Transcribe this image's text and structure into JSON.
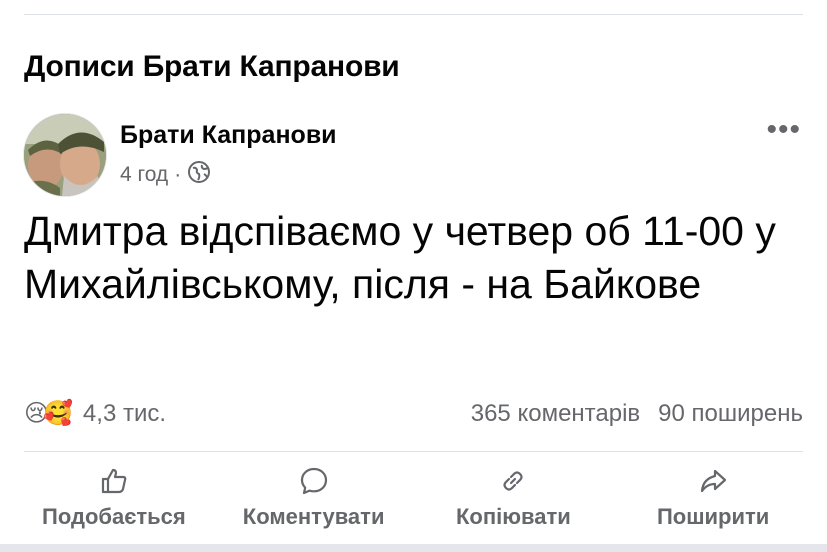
{
  "section": {
    "title": "Дописи Брати Капранови"
  },
  "post": {
    "author": "Брати Капранови",
    "time": "4 год",
    "separator": "·",
    "text": "Дмитра відспіваємо у четвер об 11-00 у Михайлівському, після - на Байкове",
    "more_label": "•••"
  },
  "stats": {
    "reactions": [
      "😢",
      "🥰"
    ],
    "reaction_count": "4,3 тис.",
    "comments": "365 коментарів",
    "shares": "90 поширень"
  },
  "actions": {
    "like": "Подобається",
    "comment": "Коментувати",
    "copy": "Копіювати",
    "share": "Поширити"
  },
  "icons": {
    "audience": "globe-icon",
    "like": "thumbs-up-icon",
    "comment": "speech-bubble-icon",
    "copy": "link-icon",
    "share": "share-arrow-icon"
  }
}
